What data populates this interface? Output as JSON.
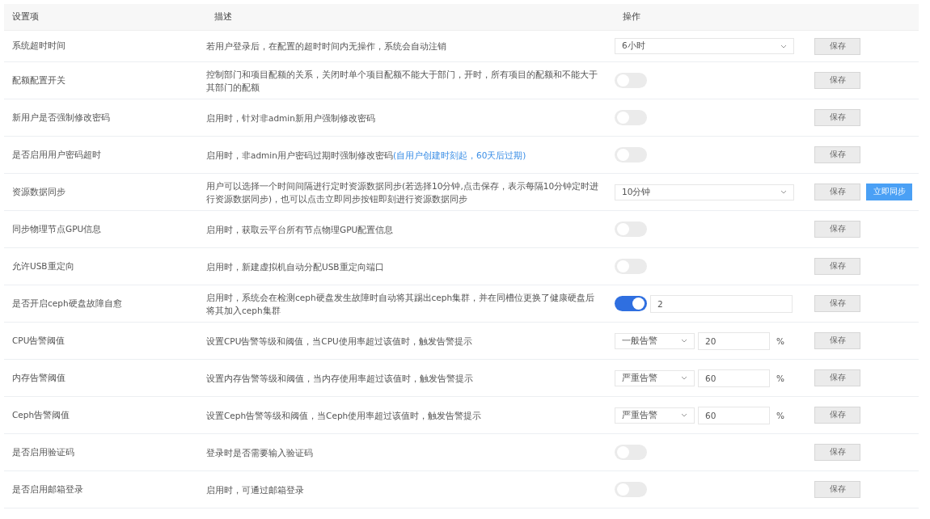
{
  "table": {
    "columns": [
      "设置项",
      "描述",
      "操作"
    ],
    "rows": [
      {
        "name": "系统超时时间",
        "description": "若用户登录后，在配置的超时时间内无操作，系统会自动注销",
        "control": {
          "kind": "select",
          "value": "6小时"
        },
        "buttons": [
          {
            "label": "保存",
            "kind": "default"
          }
        ]
      },
      {
        "name": "配额配置开关",
        "description": "控制部门和项目配额的关系，关闭时单个项目配额不能大于部门，开时，所有项目的配额和不能大于其部门的配额",
        "control": {
          "kind": "switch",
          "on": false
        },
        "buttons": [
          {
            "label": "保存",
            "kind": "default"
          }
        ]
      },
      {
        "name": "新用户是否强制修改密码",
        "description": "启用时，针对非admin新用户强制修改密码",
        "control": {
          "kind": "switch",
          "on": false
        },
        "buttons": [
          {
            "label": "保存",
            "kind": "default"
          }
        ]
      },
      {
        "name": "是否启用用户密码超时",
        "description": "启用时，非admin用户密码过期时强制修改密码",
        "note": "(自用户创建时刻起，60天后过期)",
        "control": {
          "kind": "switch",
          "on": false
        },
        "buttons": [
          {
            "label": "保存",
            "kind": "default"
          }
        ]
      },
      {
        "name": "资源数据同步",
        "description": "用户可以选择一个时间间隔进行定时资源数据同步(若选择10分钟,点击保存，表示每隔10分钟定时进行资源数据同步)，也可以点击立即同步按钮即刻进行资源数据同步",
        "control": {
          "kind": "select",
          "value": "10分钟"
        },
        "buttons": [
          {
            "label": "保存",
            "kind": "default"
          },
          {
            "label": "立即同步",
            "kind": "primary"
          }
        ]
      },
      {
        "name": "同步物理节点GPU信息",
        "description": "启用时，获取云平台所有节点物理GPU配置信息",
        "control": {
          "kind": "switch",
          "on": false
        },
        "buttons": [
          {
            "label": "保存",
            "kind": "default"
          }
        ]
      },
      {
        "name": "允许USB重定向",
        "description": "启用时，新建虚拟机自动分配USB重定向端口",
        "control": {
          "kind": "switch",
          "on": false
        },
        "buttons": [
          {
            "label": "保存",
            "kind": "default"
          }
        ]
      },
      {
        "name": "是否开启ceph硬盘故障自愈",
        "description": "启用时，系统会在检测ceph硬盘发生故障时自动将其踢出ceph集群，并在同槽位更换了健康硬盘后将其加入ceph集群",
        "control": {
          "kind": "switch_input",
          "on": true,
          "value": "2"
        },
        "buttons": [
          {
            "label": "保存",
            "kind": "default"
          }
        ]
      },
      {
        "name": "CPU告警阈值",
        "description": "设置CPU告警等级和阈值，当CPU使用率超过该值时，触发告警提示",
        "control": {
          "kind": "threshold",
          "level_value": "一般告警",
          "value": "20",
          "unit": "%"
        },
        "buttons": [
          {
            "label": "保存",
            "kind": "default"
          }
        ]
      },
      {
        "name": "内存告警阈值",
        "description": "设置内存告警等级和阈值，当内存使用率超过该值时，触发告警提示",
        "control": {
          "kind": "threshold",
          "level_value": "严重告警",
          "value": "60",
          "unit": "%"
        },
        "buttons": [
          {
            "label": "保存",
            "kind": "default"
          }
        ]
      },
      {
        "name": "Ceph告警阈值",
        "description": "设置Ceph告警等级和阈值，当Ceph使用率超过该值时，触发告警提示",
        "control": {
          "kind": "threshold",
          "level_value": "严重告警",
          "value": "60",
          "unit": "%"
        },
        "buttons": [
          {
            "label": "保存",
            "kind": "default"
          }
        ]
      },
      {
        "name": "是否启用验证码",
        "description": "登录时是否需要输入验证码",
        "control": {
          "kind": "switch",
          "on": false
        },
        "buttons": [
          {
            "label": "保存",
            "kind": "default"
          }
        ]
      },
      {
        "name": "是否启用邮箱登录",
        "description": "启用时，可通过邮箱登录",
        "control": {
          "kind": "switch",
          "on": false
        },
        "buttons": [
          {
            "label": "保存",
            "kind": "default"
          }
        ]
      }
    ]
  }
}
